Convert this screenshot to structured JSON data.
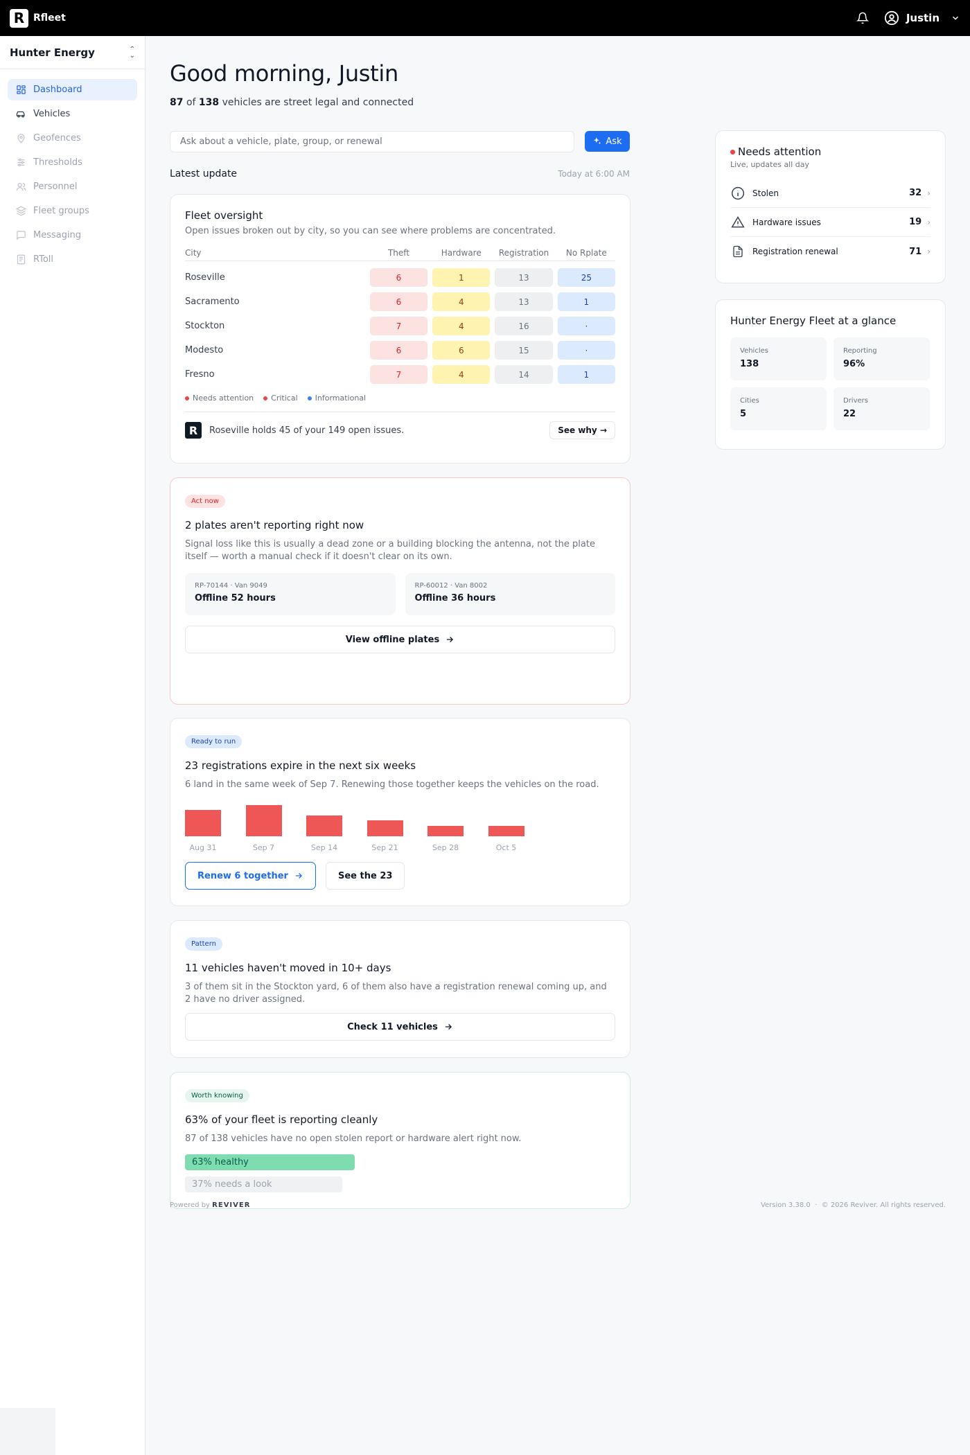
{
  "topbar": {
    "brand": "Rfleet",
    "logo_letter": "R",
    "username": "Justin",
    "icons": [
      "bell-icon",
      "user-circle-icon",
      "chevron-down-icon"
    ]
  },
  "sidebar": {
    "org": "Hunter Energy",
    "items": [
      {
        "label": "Dashboard",
        "icon": "grid-icon"
      },
      {
        "label": "Vehicles",
        "icon": "car-icon"
      },
      {
        "label": "Geofences",
        "icon": "map-pin-icon"
      },
      {
        "label": "Thresholds",
        "icon": "sliders-icon"
      },
      {
        "label": "Personnel",
        "icon": "people-icon"
      },
      {
        "label": "Fleet groups",
        "icon": "layers-icon"
      },
      {
        "label": "Messaging",
        "icon": "chat-icon"
      },
      {
        "label": "RToll",
        "icon": "receipt-icon"
      }
    ]
  },
  "header": {
    "greeting": "Good morning, Justin",
    "legal_count": "87",
    "of": "of",
    "total_count": "138",
    "legal_suffix": "vehicles are street legal and connected"
  },
  "ask": {
    "placeholder": "Ask about a vehicle, plate, group, or renewal",
    "button": "Ask"
  },
  "latest": {
    "title": "Latest update",
    "timestamp": "Today at 6:00 AM"
  },
  "oversight": {
    "title": "Fleet oversight",
    "desc": "Open issues broken out by city, so you can see where problems are concentrated.",
    "columns": [
      "City",
      "Theft",
      "Hardware",
      "Registration",
      "No Rplate"
    ],
    "rows": [
      {
        "city": "Roseville",
        "theft": "6",
        "hardware": "1",
        "registration": "13",
        "no_rplate": "25"
      },
      {
        "city": "Sacramento",
        "theft": "6",
        "hardware": "4",
        "registration": "13",
        "no_rplate": "1"
      },
      {
        "city": "Stockton",
        "theft": "7",
        "hardware": "4",
        "registration": "16",
        "no_rplate": "·"
      },
      {
        "city": "Modesto",
        "theft": "6",
        "hardware": "6",
        "registration": "15",
        "no_rplate": "·"
      },
      {
        "city": "Fresno",
        "theft": "7",
        "hardware": "4",
        "registration": "14",
        "no_rplate": "1"
      }
    ],
    "legend": [
      {
        "label": "Needs attention",
        "color": "#ef4444"
      },
      {
        "label": "Critical",
        "color": "#ef4444"
      },
      {
        "label": "Informational",
        "color": "#3b82f6"
      }
    ],
    "insight": "Roseville holds 45 of your 149 open issues.",
    "insight_button": "See why"
  },
  "offline": {
    "badge": "Act now",
    "title": "2 plates aren't reporting right now",
    "desc": "Signal loss like this is usually a dead zone or a building blocking the antenna, not the plate itself — worth a manual check if it doesn't clear on its own.",
    "plates": [
      {
        "id": "RP-70144 · Van 9049",
        "status": "Offline 52 hours"
      },
      {
        "id": "RP-60012 · Van 8002",
        "status": "Offline 36 hours"
      }
    ],
    "button": "View offline plates"
  },
  "registrations": {
    "badge": "Ready to run",
    "title": "23 registrations expire in the next six weeks",
    "desc": "6 land in the same week of Sep 7. Renewing those together keeps the vehicles on the road.",
    "primary_button": "Renew 6 together",
    "secondary_button": "See the 23"
  },
  "chart_data": {
    "type": "bar",
    "categories": [
      "Aug 31",
      "Sep 7",
      "Sep 14",
      "Sep 21",
      "Sep 28",
      "Oct 5"
    ],
    "values": [
      5,
      6,
      4,
      3,
      2,
      2
    ],
    "color": "#ef5656",
    "title": "",
    "xlabel": "",
    "ylabel": ""
  },
  "idle": {
    "badge": "Pattern",
    "title": "11 vehicles haven't moved in 10+ days",
    "desc": "3 of them sit in the Stockton yard, 6 of them also have a registration renewal coming up, and 2 have no driver assigned.",
    "button": "Check 11 vehicles"
  },
  "health": {
    "badge": "Worth knowing",
    "title": "63% of your fleet is reporting cleanly",
    "desc": "87 of 138 vehicles have no open stolen report or hardware alert right now.",
    "healthy_label": "63% healthy",
    "healthy_pct": 63,
    "needs_label": "37% needs a look",
    "needs_pct": 37
  },
  "attention": {
    "title": "Needs attention",
    "subtitle": "Live, updates all day",
    "items": [
      {
        "label": "Stolen",
        "count": "32",
        "icon": "info-circle-icon"
      },
      {
        "label": "Hardware issues",
        "count": "19",
        "icon": "warning-triangle-icon"
      },
      {
        "label": "Registration renewal",
        "count": "71",
        "icon": "document-icon"
      }
    ]
  },
  "glance": {
    "title": "Hunter Energy Fleet at a glance",
    "stats": [
      {
        "label": "Vehicles",
        "value": "138"
      },
      {
        "label": "Reporting",
        "value": "96%"
      },
      {
        "label": "Cities",
        "value": "5"
      },
      {
        "label": "Drivers",
        "value": "22"
      }
    ]
  },
  "footer": {
    "powered_by": "Powered by",
    "brand": "REVIVER",
    "version": "Version 3.38.0",
    "sep": "·",
    "copyright": "© 2026 Reviver. All rights reserved."
  }
}
